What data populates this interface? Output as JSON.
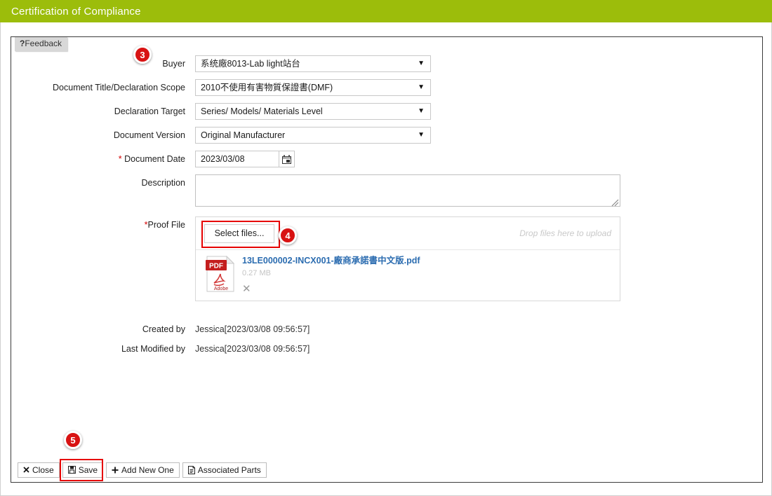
{
  "window": {
    "title": "Certification of Compliance",
    "accent_color": "#9cbd0b"
  },
  "tab": {
    "marker": "?",
    "label": "Feedback"
  },
  "form": {
    "fields": [
      {
        "label": "Buyer",
        "required": false,
        "type": "select",
        "value": "系统廠8013-Lab light站台"
      },
      {
        "label": "Document Title/Declaration Scope",
        "required": false,
        "type": "select",
        "value": "2010不使用有害物質保證書(DMF)"
      },
      {
        "label": "Declaration Target",
        "required": false,
        "type": "select",
        "value": "Series/ Models/ Materials Level"
      },
      {
        "label": "Document Version",
        "required": false,
        "type": "select",
        "value": "Original Manufacturer"
      },
      {
        "label": "Document Date",
        "required": true,
        "type": "date",
        "value": "2023/03/08"
      },
      {
        "label": "Description",
        "required": false,
        "type": "textarea",
        "value": ""
      },
      {
        "label": "Proof File",
        "required": true,
        "type": "upload",
        "value": ""
      }
    ],
    "labels": {
      "buyer": "Buyer",
      "document_title": "Document Title/Declaration Scope",
      "declaration_target": "Declaration Target",
      "document_version": "Document Version",
      "document_date": "Document Date",
      "description": "Description",
      "proof_file": "Proof File",
      "created_by": "Created by",
      "last_modified_by": "Last Modified by"
    },
    "values": {
      "buyer": "系统廠8013-Lab light站台",
      "document_title": "2010不使用有害物質保證書(DMF)",
      "declaration_target": "Series/ Models/ Materials Level",
      "document_version": "Original Manufacturer",
      "document_date": "2023/03/08",
      "description": "",
      "created_by": "Jessica[2023/03/08 09:56:57]",
      "last_modified_by": "Jessica[2023/03/08 09:56:57]"
    },
    "required_marker": "*"
  },
  "upload": {
    "select_files_label": "Select files...",
    "drop_hint": "Drop files here to upload",
    "files": [
      {
        "name": "13LE000002-INCX001-廠商承諾書中文版.pdf",
        "size": "0.27 MB",
        "type": "PDF",
        "brand": "Adobe",
        "remove_label": "✕"
      }
    ]
  },
  "toolbar": {
    "buttons": [
      {
        "label": "Close",
        "icon": "close-icon"
      },
      {
        "label": "Save",
        "icon": "save-icon"
      },
      {
        "label": "Add New One",
        "icon": "plus-icon"
      },
      {
        "label": "Associated Parts",
        "icon": "document-icon"
      }
    ],
    "close_label": "Close",
    "save_label": "Save",
    "add_new_one_label": "Add New One",
    "associated_parts_label": "Associated Parts"
  },
  "annotations": {
    "badges": [
      {
        "number": "3",
        "target": "buyer-field"
      },
      {
        "number": "4",
        "target": "select-files-button"
      },
      {
        "number": "5",
        "target": "save-button"
      }
    ],
    "badge3": "3",
    "badge4": "4",
    "badge5": "5",
    "highlight_color": "#e60000"
  }
}
